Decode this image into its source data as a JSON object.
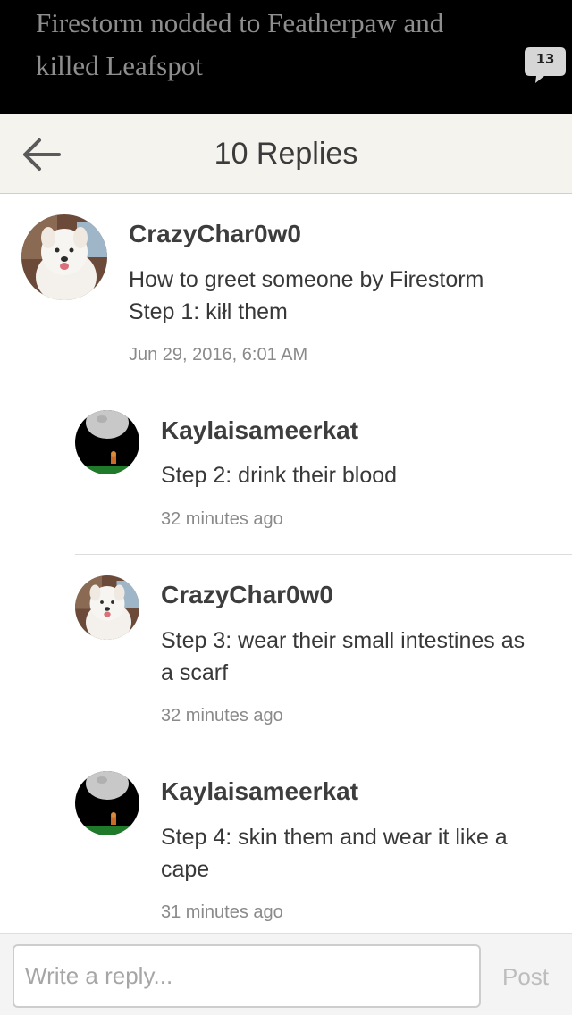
{
  "quote": {
    "text_line1": "Firestorm nodded to Featherpaw and",
    "text_line2": "killed Leafspot",
    "comment_count": "13"
  },
  "header": {
    "title": "10 Replies",
    "back_icon": "back-arrow-icon"
  },
  "comments": [
    {
      "username": "CrazyChar0w0",
      "lines": [
        "How to greet someone by Firestorm",
        "Step 1: kiłl them"
      ],
      "timestamp": "Jun 29, 2016, 6:01 AM",
      "avatar": "dog-avatar"
    },
    {
      "username": "Kaylaisameerkat",
      "lines": [
        "Step 2: drink their blood"
      ],
      "timestamp": "32 minutes ago",
      "avatar": "moon-cat-avatar"
    },
    {
      "username": "CrazyChar0w0",
      "lines": [
        "Step 3: wear their small intestines as",
        "a scarf"
      ],
      "timestamp": "32 minutes ago",
      "avatar": "dog-avatar"
    },
    {
      "username": "Kaylaisameerkat",
      "lines": [
        "Step 4: skin them and wear it like a",
        "cape"
      ],
      "timestamp": "31 minutes ago",
      "avatar": "moon-cat-avatar"
    }
  ],
  "reply": {
    "placeholder": "Write a reply...",
    "post_label": "Post"
  },
  "colors": {
    "quote_background": "#000000",
    "header_background": "#f5f3ee",
    "post_disabled": "#bdbdbd"
  }
}
